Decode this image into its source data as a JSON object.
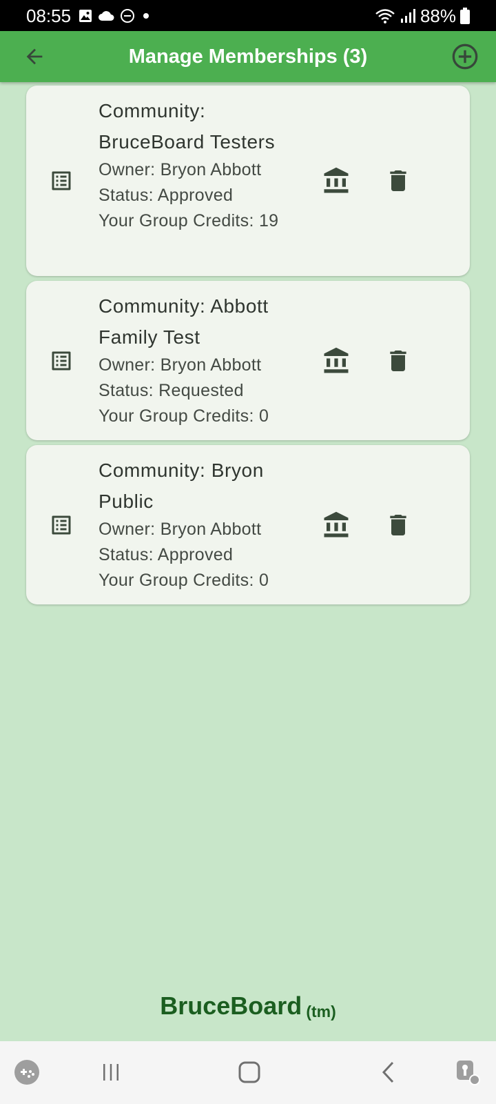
{
  "status_bar": {
    "time": "08:55",
    "battery": "88%"
  },
  "app_bar": {
    "title": "Manage Memberships (3)"
  },
  "memberships": [
    {
      "title": "Community: BruceBoard Testers",
      "owner": "Owner: Bryon Abbott",
      "status": "Status: Approved",
      "credits": "Your Group Credits: 19"
    },
    {
      "title": "Community: Abbott Family Test",
      "owner": "Owner: Bryon Abbott",
      "status": "Status: Requested",
      "credits": "Your Group Credits: 0"
    },
    {
      "title": "Community: Bryon Public",
      "owner": "Owner: Bryon Abbott",
      "status": "Status: Approved",
      "credits": "Your Group Credits: 0"
    }
  ],
  "footer": {
    "brand": "BruceBoard",
    "tm": "(tm)"
  },
  "icons": {
    "back": "arrow-left-icon",
    "add": "add-circle-icon",
    "list": "list-alt-icon",
    "bank": "bank-icon",
    "delete": "trash-icon"
  },
  "colors": {
    "app_bar": "#4caf50",
    "background": "#c8e6c9",
    "card": "#f1f5ee",
    "brand": "#1b5e20",
    "icon": "#3c4a3c"
  }
}
